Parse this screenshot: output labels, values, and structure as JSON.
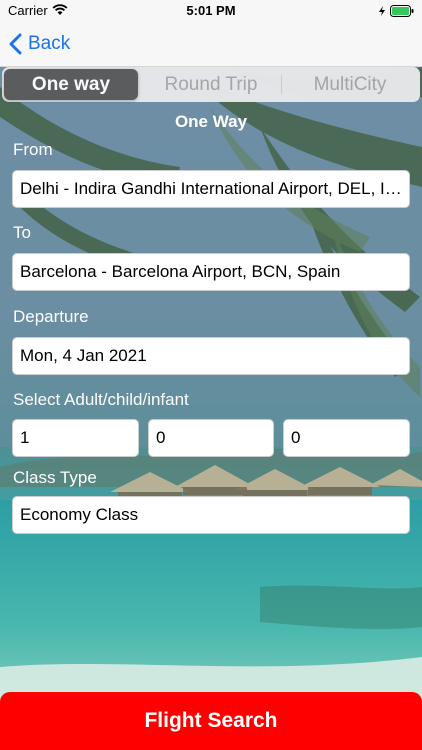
{
  "status_bar": {
    "carrier": "Carrier",
    "time": "5:01 PM"
  },
  "nav": {
    "back_label": "Back"
  },
  "tabs": [
    {
      "label": "One way",
      "selected": true
    },
    {
      "label": "Round Trip",
      "selected": false
    },
    {
      "label": "MultiCity",
      "selected": false
    }
  ],
  "form": {
    "title": "One Way",
    "from_label": "From",
    "from_value": "Delhi - Indira Gandhi International Airport, DEL, India",
    "to_label": "To",
    "to_value": "Barcelona - Barcelona Airport, BCN, Spain",
    "departure_label": "Departure",
    "departure_value": "Mon, 4 Jan 2021",
    "passengers_label": "Select Adult/child/infant",
    "adults": "1",
    "children": "0",
    "infants": "0",
    "class_label": "Class Type",
    "class_value": "Economy Class"
  },
  "actions": {
    "search_label": "Flight Search"
  },
  "colors": {
    "accent": "#1a73e8",
    "primary_button": "#ff0000",
    "tab_active": "#5b5b5b"
  }
}
